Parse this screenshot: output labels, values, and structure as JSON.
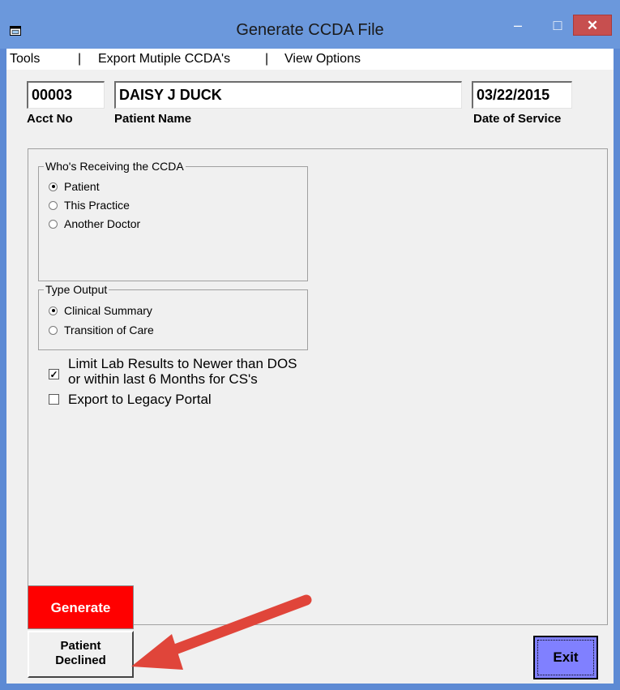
{
  "window": {
    "title": "Generate CCDA File",
    "controls": {
      "minimize": "–",
      "maximize": "□",
      "close": "✕"
    }
  },
  "menu": {
    "items": [
      "Tools",
      "|",
      "Export Mutiple CCDA's",
      "|",
      "View Options"
    ]
  },
  "header": {
    "acct_no": {
      "value": "00003",
      "label": "Acct No"
    },
    "patient_name": {
      "value": "DAISY J DUCK",
      "label": "Patient Name"
    },
    "date_of_service": {
      "value": "03/22/2015",
      "label": "Date of Service"
    }
  },
  "receiving": {
    "title": "Who's Receiving the CCDA",
    "options": [
      {
        "label": "Patient",
        "selected": true
      },
      {
        "label": "This Practice",
        "selected": false
      },
      {
        "label": "Another Doctor",
        "selected": false
      }
    ]
  },
  "output": {
    "title": "Type Output",
    "options": [
      {
        "label": "Clinical Summary",
        "selected": true
      },
      {
        "label": "Transition of Care",
        "selected": false
      }
    ]
  },
  "checkboxes": {
    "limit_lab": {
      "line1": "Limit Lab Results to Newer than DOS",
      "line2": "or within last 6 Months for CS's",
      "checked": true
    },
    "legacy_portal": {
      "label": "Export to Legacy Portal",
      "checked": false
    }
  },
  "buttons": {
    "generate": "Generate",
    "declined_line1": "Patient",
    "declined_line2": "Declined",
    "exit": "Exit"
  },
  "colors": {
    "titlebar": "#6b98dc",
    "generate_bg": "#ff0000",
    "exit_bg": "#8080ff",
    "annotation_arrow": "#e0453a"
  }
}
